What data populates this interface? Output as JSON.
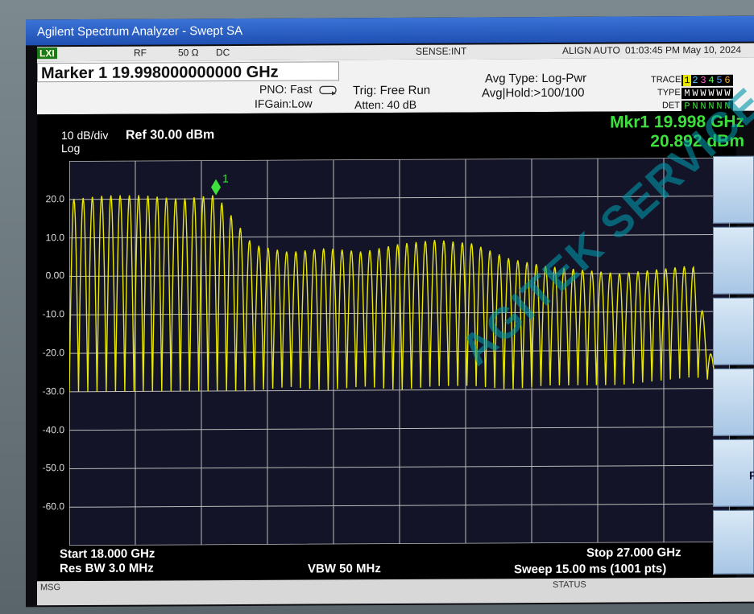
{
  "window": {
    "title": "Agilent Spectrum Analyzer - Swept SA"
  },
  "status_row": {
    "lxi": "LXI",
    "rf": "RF",
    "impedance": "50 Ω",
    "coupling": "DC",
    "sense": "SENSE:INT",
    "align": "ALIGN AUTO",
    "datetime": "01:03:45 PM May 10, 2024"
  },
  "header": {
    "marker": "Marker 1 19.998000000000 GHz",
    "pno": "PNO: Fast",
    "ifgain": "IFGain:Low",
    "trig": "Trig: Free Run",
    "atten": "Atten: 40 dB",
    "avg_type": "Avg Type: Log-Pwr",
    "avg_hold": "Avg|Hold:>100/100",
    "trace_label": "TRACE",
    "type_label": "TYPE",
    "det_label": "DET",
    "trace_nums": [
      "1",
      "2",
      "3",
      "4",
      "5",
      "6"
    ],
    "type_chars": [
      "M",
      "W",
      "W",
      "W",
      "W",
      "W"
    ],
    "det_chars": [
      "P",
      "N",
      "N",
      "N",
      "N",
      "N"
    ]
  },
  "plot": {
    "scale": "10 dB/div",
    "scale_type": "Log",
    "ref": "Ref 30.00 dBm",
    "mkr_freq": "Mkr1 19.998 GHz",
    "mkr_amp": "20.892 dBm",
    "marker_label": "1",
    "y_ticks": [
      "20.0",
      "10.0",
      "0.00",
      "-10.0",
      "-20.0",
      "-30.0",
      "-40.0",
      "-50.0",
      "-60.0"
    ],
    "start": "Start 18.000 GHz",
    "res_bw": "Res BW 3.0 MHz",
    "vbw": "VBW 50 MHz",
    "stop": "Stop 27.000 GHz",
    "sweep": "Sweep  15.00 ms (1001 pts)"
  },
  "softkeys": {
    "visible_label": "Pr"
  },
  "msgbar": {
    "msg": "MSG",
    "status": "STATUS"
  },
  "watermark": {
    "text": "AGITEK SERVICE"
  },
  "colors": {
    "trace": "#e8e800",
    "marker_text": "#3ee03e",
    "grid": "#bbbbbb",
    "title_bar": "#2a5fc7"
  },
  "chart_data": {
    "type": "line",
    "title": "",
    "xlabel": "",
    "ylabel": "",
    "x_range_ghz": [
      18.0,
      27.0
    ],
    "ylim": [
      -70,
      30
    ],
    "y_unit": "dBm",
    "grid": true,
    "marker": {
      "x": 19.998,
      "y": 20.892
    },
    "envelope": {
      "x": [
        18.0,
        18.5,
        19.0,
        19.5,
        20.0,
        20.5,
        21.0,
        21.5,
        22.0,
        22.5,
        23.0,
        23.5,
        24.0,
        24.5,
        25.0,
        25.5,
        26.0,
        26.5,
        26.8,
        27.0
      ],
      "upper": [
        20,
        21,
        21,
        20,
        21,
        8,
        6,
        7,
        6,
        8,
        9,
        8,
        4,
        2,
        1,
        0,
        1,
        2,
        -26,
        -27
      ],
      "lower": [
        -30,
        -30,
        -30,
        -30,
        -30,
        -30,
        -29,
        -30,
        -29,
        -30,
        -29,
        -29,
        -30,
        -29,
        -29,
        -29,
        -28,
        -27,
        -28,
        -27
      ]
    }
  }
}
